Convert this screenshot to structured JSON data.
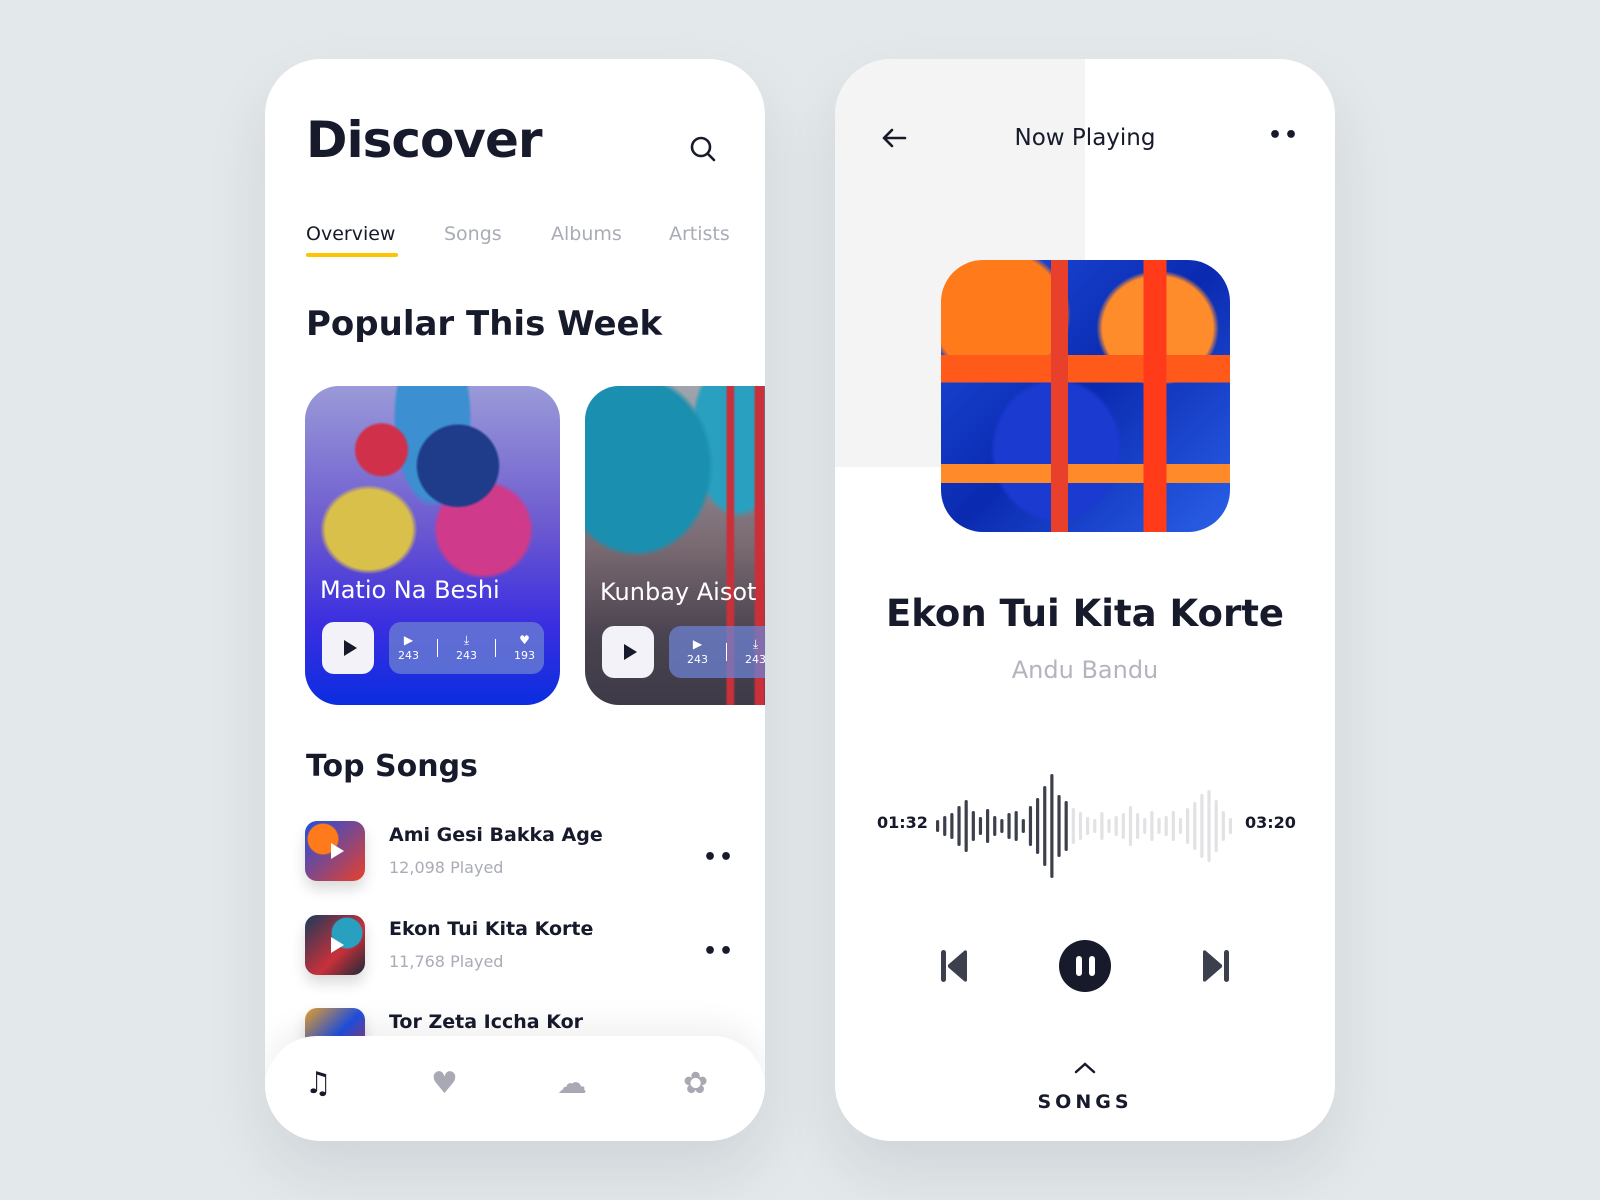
{
  "discover": {
    "title": "Discover",
    "tabs": [
      {
        "label": "Overview",
        "active": true
      },
      {
        "label": "Songs"
      },
      {
        "label": "Albums"
      },
      {
        "label": "Artists"
      }
    ],
    "accent": "#ffc400",
    "popular_heading": "Popular This Week",
    "cards": [
      {
        "name": "Matio Na Beshi",
        "plays": "243",
        "downloads": "243",
        "likes": "193"
      },
      {
        "name": "Kunbay Aisot",
        "plays": "243",
        "downloads": "243"
      }
    ],
    "top_heading": "Top Songs",
    "songs": [
      {
        "title": "Ami Gesi Bakka Age",
        "played": "12,098 Played"
      },
      {
        "title": "Ekon Tui Kita Korte",
        "played": "11,768 Played"
      },
      {
        "title": "Tor Zeta Iccha Kor"
      }
    ],
    "nav": [
      "music-icon",
      "heart-icon",
      "cloud-download-icon",
      "settings-icon"
    ]
  },
  "now_playing": {
    "header": "Now Playing",
    "song_title": "Ekon Tui Kita Korte",
    "artist": "Andu Bandu",
    "elapsed": "01:32",
    "duration": "03:20",
    "progress": 0.46,
    "songs_label": "SONGS"
  }
}
